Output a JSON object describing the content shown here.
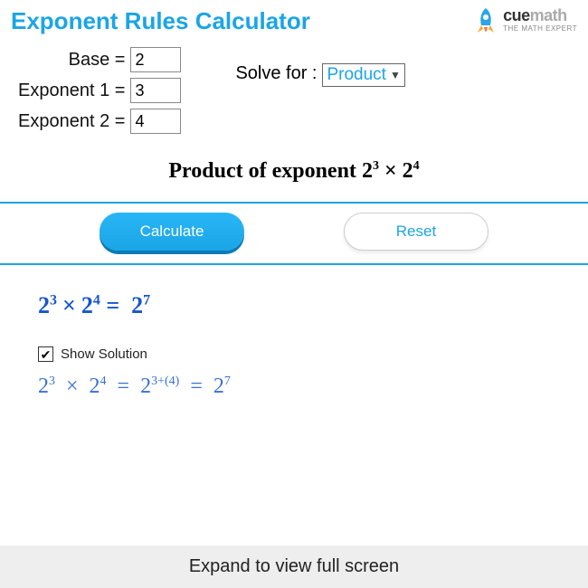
{
  "title": "Exponent Rules Calculator",
  "logo": {
    "brand_a": "cue",
    "brand_b": "math",
    "tagline": "THE MATH EXPERT"
  },
  "inputs": {
    "base_label": "Base =",
    "base_value": "2",
    "exp1_label": "Exponent 1 =",
    "exp1_value": "3",
    "exp2_label": "Exponent 2 =",
    "exp2_value": "4",
    "solve_label": "Solve for :",
    "solve_value": "Product"
  },
  "main_equation": {
    "prefix": "Product of exponent ",
    "b1": "2",
    "e1": "3",
    "b2": "2",
    "e2": "4"
  },
  "buttons": {
    "calculate": "Calculate",
    "reset": "Reset"
  },
  "result": {
    "b1": "2",
    "e1": "3",
    "b2": "2",
    "e2": "4",
    "br": "2",
    "er": "7"
  },
  "show_solution": {
    "label": "Show Solution",
    "checked": true
  },
  "solution": {
    "b1": "2",
    "e1": "3",
    "b2": "2",
    "e2": "4",
    "bm": "2",
    "em": "3+(4)",
    "br": "2",
    "er": "7"
  },
  "footer": "Expand to view full screen"
}
